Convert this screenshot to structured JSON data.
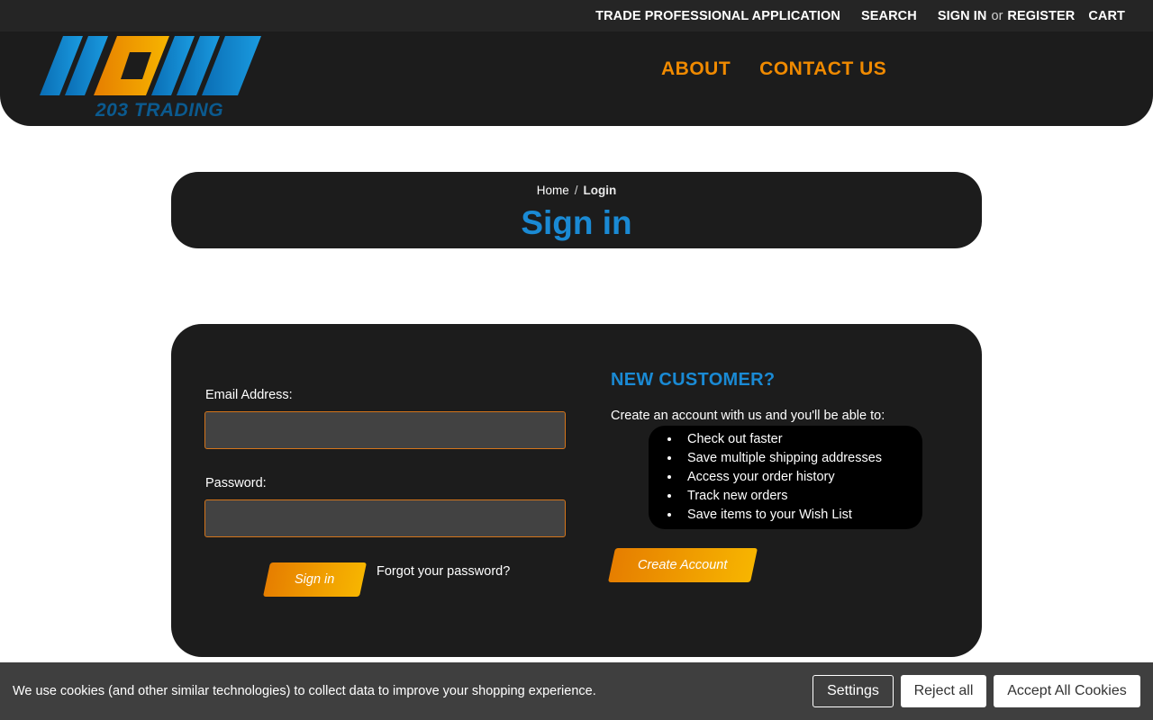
{
  "topbar": {
    "trade_application": "TRADE PROFESSIONAL APPLICATION",
    "search": "SEARCH",
    "sign_in": "SIGN IN",
    "or": "or",
    "register": "REGISTER",
    "cart": "CART"
  },
  "header": {
    "logo_text": "203 TRADING",
    "nav": {
      "about": "ABOUT",
      "contact": "CONTACT US"
    }
  },
  "breadcrumb": {
    "home": "Home",
    "separator": "/",
    "current": "Login"
  },
  "page_title": "Sign in",
  "login_form": {
    "email_label": "Email Address:",
    "email_value": "",
    "password_label": "Password:",
    "password_value": "",
    "sign_in_button": "Sign in",
    "forgot_link": "Forgot your password?"
  },
  "new_customer": {
    "title": "NEW CUSTOMER?",
    "intro": "Create an account with us and you'll be able to:",
    "benefits": [
      "Check out faster",
      "Save multiple shipping addresses",
      "Access your order history",
      "Track new orders",
      "Save items to your Wish List"
    ],
    "create_button": "Create Account"
  },
  "cookie_bar": {
    "message": "We use cookies (and other similar technologies) to collect data to improve your shopping experience.",
    "settings": "Settings",
    "reject": "Reject all",
    "accept": "Accept All Cookies"
  },
  "colors": {
    "accent_orange": "#f08a00",
    "accent_blue": "#1a8ad4",
    "panel": "#1c1c1c",
    "topbar": "#252525"
  }
}
